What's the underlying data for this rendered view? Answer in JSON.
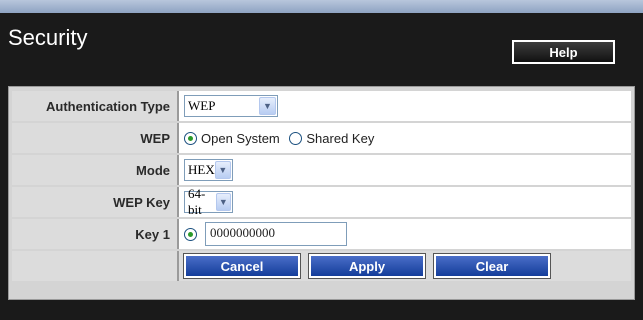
{
  "header": {
    "title": "Security",
    "help_label": "Help"
  },
  "form": {
    "auth_type": {
      "label": "Authentication Type",
      "value": "WEP"
    },
    "wep": {
      "label": "WEP",
      "options": [
        "Open System",
        "Shared Key"
      ],
      "selected": "Open System"
    },
    "mode": {
      "label": "Mode",
      "value": "HEX"
    },
    "wep_key": {
      "label": "WEP Key",
      "value": "64-bit"
    },
    "key1": {
      "label": "Key 1",
      "value": "0000000000"
    }
  },
  "buttons": {
    "cancel": "Cancel",
    "apply": "Apply",
    "clear": "Clear"
  },
  "colors": {
    "accent_button": "#2a52b0",
    "panel_bg": "#d4d4d4",
    "header_bg": "#1a1a1a",
    "radio_checked": "#2a9a2a"
  }
}
